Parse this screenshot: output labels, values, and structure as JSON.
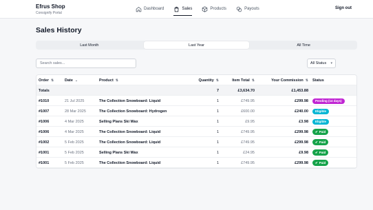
{
  "app": {
    "name": "Efrus Shop",
    "subtitle": "Consignify Portal"
  },
  "nav": [
    {
      "label": "Dashboard",
      "icon": "home-icon",
      "active": false
    },
    {
      "label": "Sales",
      "icon": "shopping-bag-icon",
      "active": true
    },
    {
      "label": "Products",
      "icon": "box-icon",
      "active": false
    },
    {
      "label": "Payouts",
      "icon": "coins-icon",
      "active": false
    }
  ],
  "signout_label": "Sign out",
  "page_title": "Sales History",
  "range_tabs": [
    {
      "label": "Last Month",
      "active": false
    },
    {
      "label": "Last Year",
      "active": true
    },
    {
      "label": "All Time",
      "active": false
    }
  ],
  "search": {
    "placeholder": "Search sales...",
    "value": ""
  },
  "status_filter": {
    "value": "All Status"
  },
  "colors": {
    "pending": "#c026d3",
    "eligible": "#06b6d4",
    "paid": "#16a34a"
  },
  "table": {
    "columns": [
      "Order",
      "Date",
      "Product",
      "Quantity",
      "Item Total",
      "Your Commission",
      "Status"
    ],
    "totals": {
      "label": "Totals",
      "quantity": "7",
      "item_total": "£3,634.70",
      "commission": "£1,453.88"
    },
    "rows": [
      {
        "order": "#1010",
        "date": "21 Jul 2025",
        "product": "The Collection Snowboard: Liquid",
        "quantity": "1",
        "item_total": "£749.95",
        "commission": "£299.98",
        "status": "Pending (14 days)",
        "status_kind": "pending"
      },
      {
        "order": "#1007",
        "date": "28 Mar 2025",
        "product": "The Collection Snowboard: Hydrogen",
        "quantity": "1",
        "item_total": "£600.00",
        "commission": "£240.00",
        "status": "Eligible",
        "status_kind": "eligible"
      },
      {
        "order": "#1006",
        "date": "4 Mar 2025",
        "product": "Selling Plans Ski Wax",
        "quantity": "1",
        "item_total": "£9.95",
        "commission": "£3.98",
        "status": "Eligible",
        "status_kind": "eligible"
      },
      {
        "order": "#1006",
        "date": "4 Mar 2025",
        "product": "The Collection Snowboard: Liquid",
        "quantity": "1",
        "item_total": "£749.95",
        "commission": "£299.98",
        "status": "Paid",
        "status_kind": "paid"
      },
      {
        "order": "#1002",
        "date": "5 Feb 2025",
        "product": "The Collection Snowboard: Liquid",
        "quantity": "1",
        "item_total": "£749.95",
        "commission": "£299.98",
        "status": "Paid",
        "status_kind": "paid"
      },
      {
        "order": "#1001",
        "date": "5 Feb 2025",
        "product": "Selling Plans Ski Wax",
        "quantity": "1",
        "item_total": "£24.95",
        "commission": "£9.98",
        "status": "Paid",
        "status_kind": "paid"
      },
      {
        "order": "#1001",
        "date": "5 Feb 2025",
        "product": "The Collection Snowboard: Liquid",
        "quantity": "1",
        "item_total": "£749.95",
        "commission": "£299.98",
        "status": "Paid",
        "status_kind": "paid"
      }
    ]
  }
}
